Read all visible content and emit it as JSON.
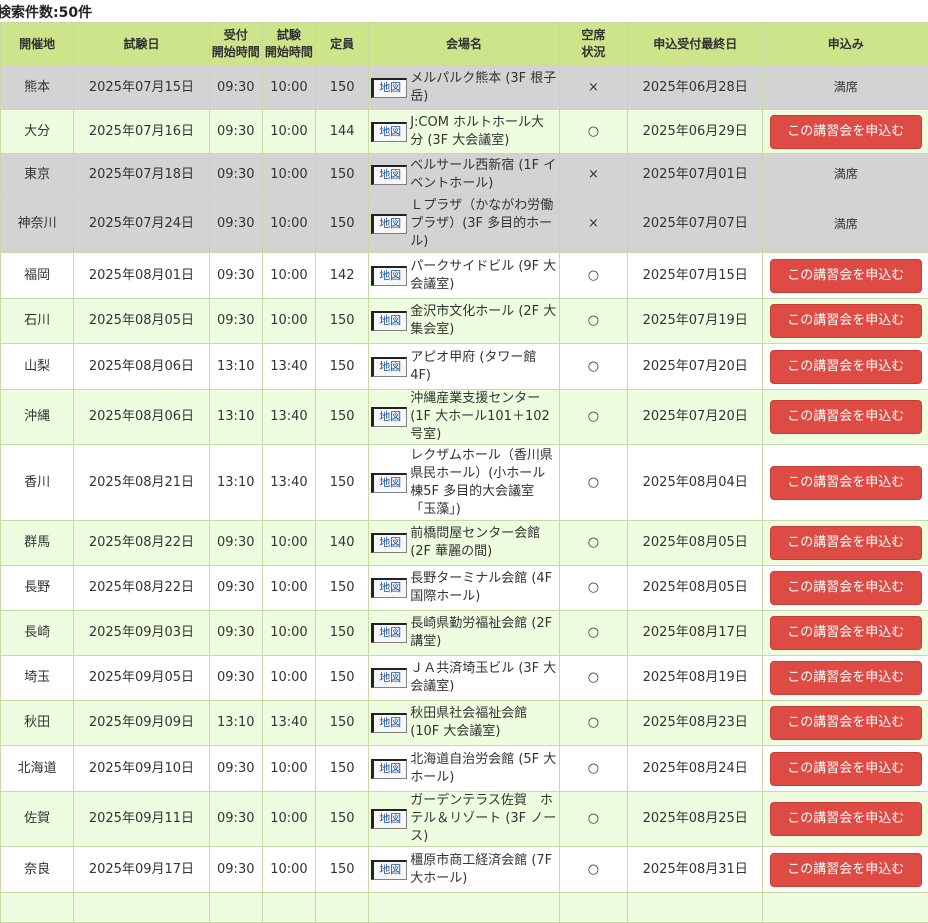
{
  "search_count_label": "検索件数:50件",
  "colors": {
    "header_bg": "#cde48a",
    "row_full_bg": "#d3d3d3",
    "row_alt_bg": "#eefde0",
    "row_white_bg": "#ffffff",
    "apply_button": "#dd4b44"
  },
  "headers": {
    "region": "開催地",
    "exam_date": "試験日",
    "reception_line1": "受付",
    "reception_line2": "開始時間",
    "exam_line1": "試験",
    "exam_line2": "開始時間",
    "capacity": "定員",
    "venue": "会場名",
    "availability_line1": "空席",
    "availability_line2": "状況",
    "deadline": "申込受付最終日",
    "apply": "申込み"
  },
  "map_label": "地図",
  "apply_label": "この講習会を申込む",
  "full_label": "満席",
  "rows": [
    {
      "region": "熊本",
      "date": "2025年07月15日",
      "reception": "09:30",
      "start": "10:00",
      "capacity": "150",
      "venue": "メルパルク熊本 (3F 根子岳)",
      "status": "×",
      "deadline": "2025年06月28日",
      "full": true,
      "height": 44
    },
    {
      "region": "大分",
      "date": "2025年07月16日",
      "reception": "09:30",
      "start": "10:00",
      "capacity": "144",
      "venue": "J:COM ホルトホール大分 (3F 大会議室)",
      "status": "○",
      "deadline": "2025年06月29日",
      "full": false,
      "height": 44
    },
    {
      "region": "東京",
      "date": "2025年07月18日",
      "reception": "09:30",
      "start": "10:00",
      "capacity": "150",
      "venue": "ベルサール西新宿 (1F イベントホール)",
      "status": "×",
      "deadline": "2025年07月01日",
      "full": true,
      "height": 42
    },
    {
      "region": "神奈川",
      "date": "2025年07月24日",
      "reception": "09:30",
      "start": "10:00",
      "capacity": "150",
      "venue": "Ｌプラザ（かながわ労働プラザ）(3F 多目的ホール)",
      "status": "×",
      "deadline": "2025年07月07日",
      "full": true,
      "height": 57
    },
    {
      "region": "福岡",
      "date": "2025年08月01日",
      "reception": "09:30",
      "start": "10:00",
      "capacity": "142",
      "venue": "パークサイドビル (9F 大会議室)",
      "status": "○",
      "deadline": "2025年07月15日",
      "full": false,
      "height": 46
    },
    {
      "region": "石川",
      "date": "2025年08月05日",
      "reception": "09:30",
      "start": "10:00",
      "capacity": "150",
      "venue": "金沢市文化ホール (2F 大集会室)",
      "status": "○",
      "deadline": "2025年07月19日",
      "full": false,
      "height": 45
    },
    {
      "region": "山梨",
      "date": "2025年08月06日",
      "reception": "13:10",
      "start": "13:40",
      "capacity": "150",
      "venue": "アピオ甲府 (タワー館 4F)",
      "status": "○",
      "deadline": "2025年07月20日",
      "full": false,
      "height": 46
    },
    {
      "region": "沖縄",
      "date": "2025年08月06日",
      "reception": "13:10",
      "start": "13:40",
      "capacity": "150",
      "venue": "沖縄産業支援センター (1F 大ホール101＋102号室)",
      "status": "○",
      "deadline": "2025年07月20日",
      "full": false,
      "height": 55
    },
    {
      "region": "香川",
      "date": "2025年08月21日",
      "reception": "13:10",
      "start": "13:40",
      "capacity": "150",
      "venue": "レクザムホール（香川県県民ホール）(小ホール棟5F 多目的大会議室「玉藻」)",
      "status": "○",
      "deadline": "2025年08月04日",
      "full": false,
      "height": 76
    },
    {
      "region": "群馬",
      "date": "2025年08月22日",
      "reception": "09:30",
      "start": "10:00",
      "capacity": "140",
      "venue": "前橋問屋センター会館 (2F 華麗の間)",
      "status": "○",
      "deadline": "2025年08月05日",
      "full": false,
      "height": 45
    },
    {
      "region": "長野",
      "date": "2025年08月22日",
      "reception": "09:30",
      "start": "10:00",
      "capacity": "150",
      "venue": "長野ターミナル会館 (4F 国際ホール)",
      "status": "○",
      "deadline": "2025年08月05日",
      "full": false,
      "height": 45
    },
    {
      "region": "長崎",
      "date": "2025年09月03日",
      "reception": "09:30",
      "start": "10:00",
      "capacity": "150",
      "venue": "長崎県勤労福祉会館 (2F 講堂)",
      "status": "○",
      "deadline": "2025年08月17日",
      "full": false,
      "height": 45
    },
    {
      "region": "埼玉",
      "date": "2025年09月05日",
      "reception": "09:30",
      "start": "10:00",
      "capacity": "150",
      "venue": "ＪＡ共済埼玉ビル (3F 大会議室)",
      "status": "○",
      "deadline": "2025年08月19日",
      "full": false,
      "height": 45
    },
    {
      "region": "秋田",
      "date": "2025年09月09日",
      "reception": "13:10",
      "start": "13:40",
      "capacity": "150",
      "venue": "秋田県社会福祉会館 (10F 大会議室)",
      "status": "○",
      "deadline": "2025年08月23日",
      "full": false,
      "height": 45
    },
    {
      "region": "北海道",
      "date": "2025年09月10日",
      "reception": "09:30",
      "start": "10:00",
      "capacity": "150",
      "venue": "北海道自治労会館 (5F 大ホール)",
      "status": "○",
      "deadline": "2025年08月24日",
      "full": false,
      "height": 46
    },
    {
      "region": "佐賀",
      "date": "2025年09月11日",
      "reception": "09:30",
      "start": "10:00",
      "capacity": "150",
      "venue": "ガーデンテラス佐賀　ホテル＆リゾート (3F ノース)",
      "status": "○",
      "deadline": "2025年08月25日",
      "full": false,
      "height": 55
    },
    {
      "region": "奈良",
      "date": "2025年09月17日",
      "reception": "09:30",
      "start": "10:00",
      "capacity": "150",
      "venue": "橿原市商工経済会館 (7F 大ホール)",
      "status": "○",
      "deadline": "2025年08月31日",
      "full": false,
      "height": 46
    },
    {
      "region": "",
      "date": "",
      "reception": "",
      "start": "",
      "capacity": "",
      "venue": "",
      "status": "",
      "deadline": "",
      "full": false,
      "height": 30
    }
  ]
}
